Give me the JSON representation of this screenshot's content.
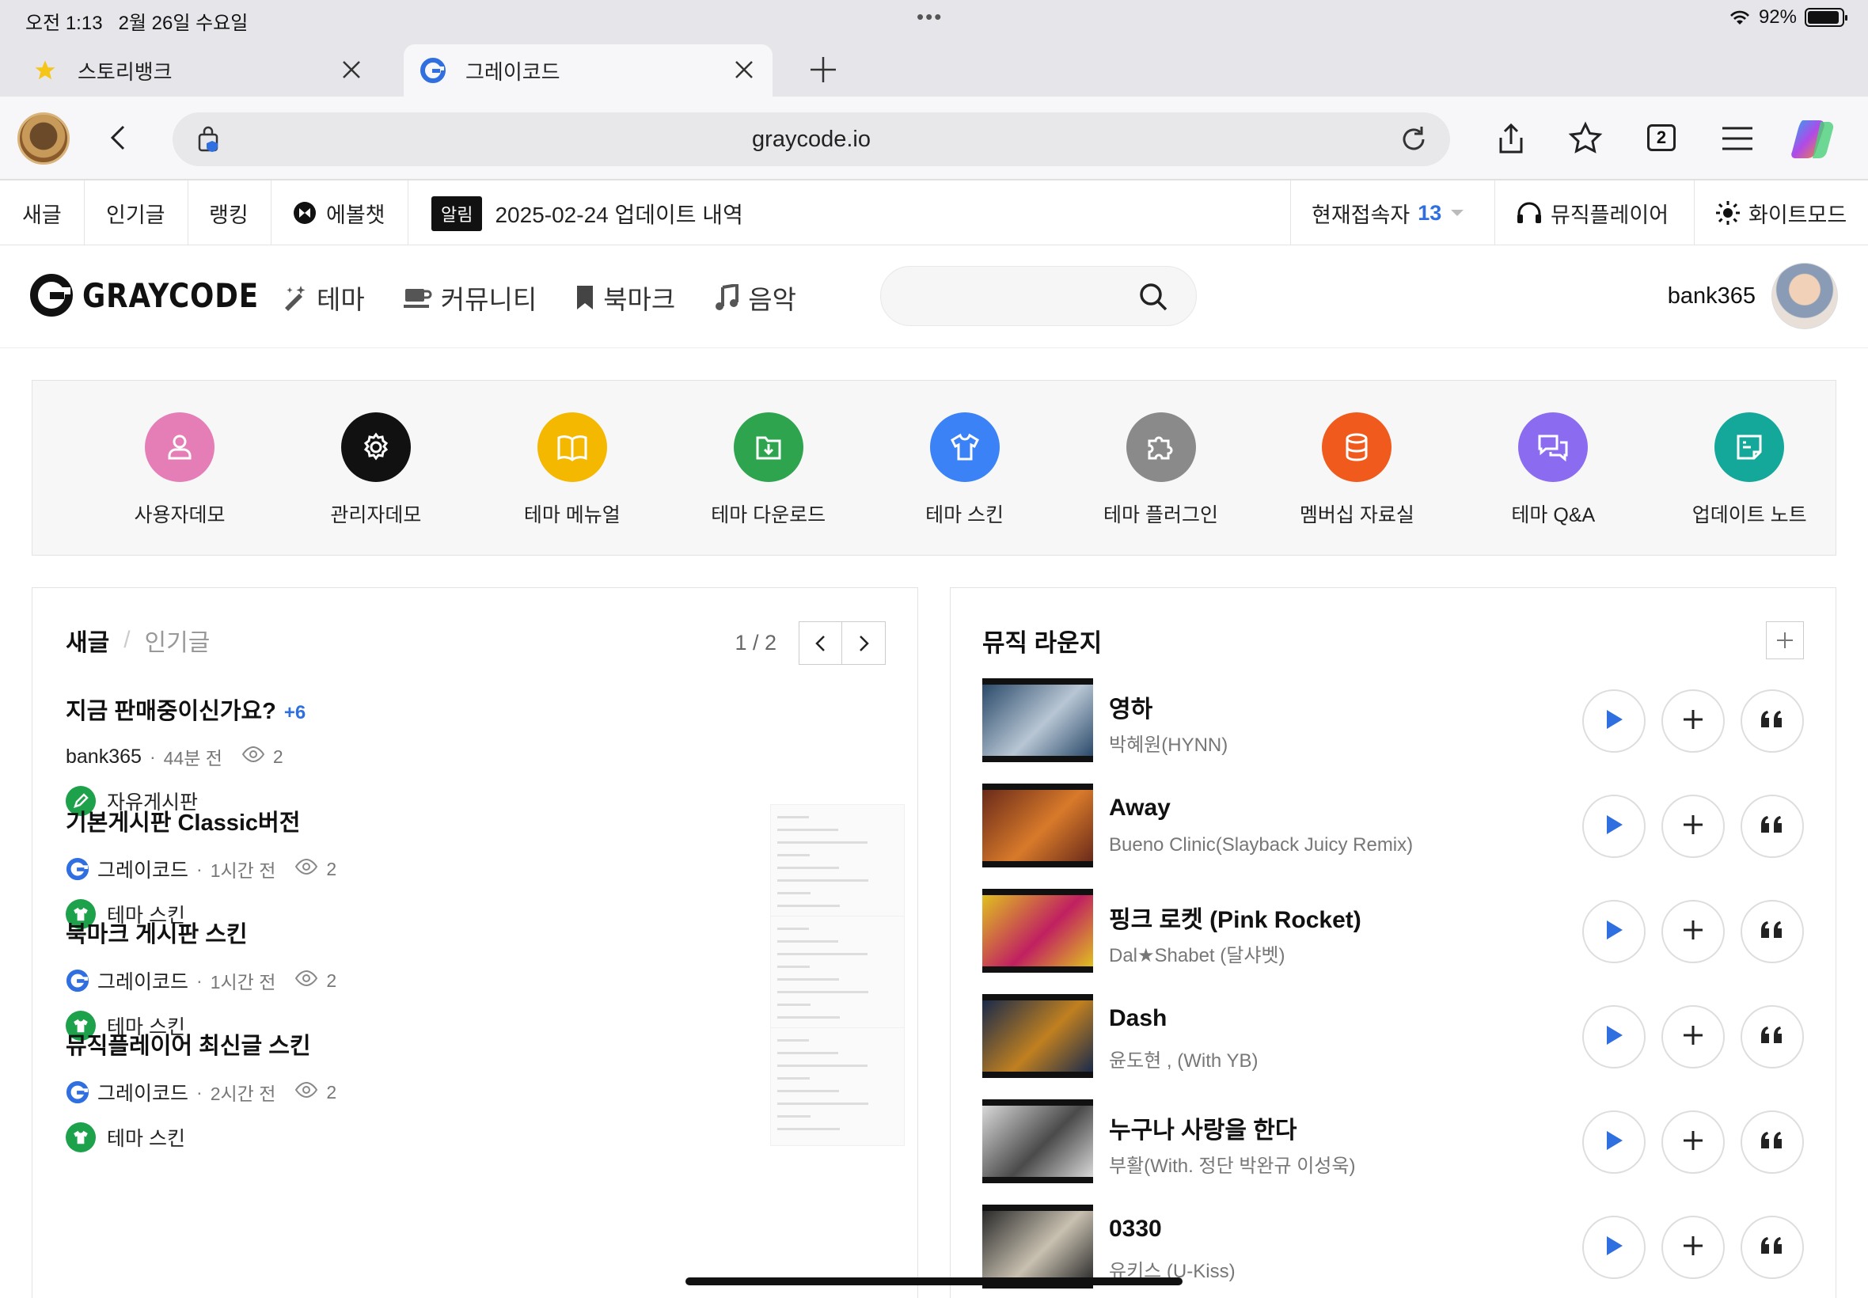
{
  "status": {
    "time": "오전 1:13",
    "date": "2월 26일 수요일",
    "battery": "92%",
    "battery_level": 0.92
  },
  "browser_tabs": [
    {
      "label": "스토리뱅크",
      "icon": "star-icon"
    },
    {
      "label": "그레이코드",
      "icon": "graycode-logo-icon"
    }
  ],
  "address": {
    "url": "graycode.io",
    "tab_count": "2"
  },
  "sitebar": {
    "new": "새글",
    "popular": "인기글",
    "ranking": "랭킹",
    "chat": "에볼챗",
    "alert_badge": "알림",
    "alert_text": "2025-02-24 업데이트 내역",
    "online_label": "현재접속자",
    "online_count": "13",
    "music_player": "뮤직플레이어",
    "white_mode": "화이트모드"
  },
  "header": {
    "logo": "GRAYCODE",
    "nav": [
      "테마",
      "커뮤니티",
      "북마크",
      "음악"
    ],
    "username": "bank365"
  },
  "quick_menu": [
    {
      "label": "사용자데모",
      "color": "#e57eb6",
      "icon": "user-icon"
    },
    {
      "label": "관리자데모",
      "color": "#111111",
      "icon": "gear-icon"
    },
    {
      "label": "테마 메뉴얼",
      "color": "#f5b800",
      "icon": "book-icon"
    },
    {
      "label": "테마 다운로드",
      "color": "#2ea44f",
      "icon": "download-icon"
    },
    {
      "label": "테마 스킨",
      "color": "#3b82f6",
      "icon": "shirt-icon"
    },
    {
      "label": "테마 플러그인",
      "color": "#8a8a8a",
      "icon": "puzzle-icon"
    },
    {
      "label": "멤버십 자료실",
      "color": "#f05a1c",
      "icon": "database-icon"
    },
    {
      "label": "테마 Q&A",
      "color": "#8b6cf0",
      "icon": "chat-icon"
    },
    {
      "label": "업데이트 노트",
      "color": "#14a89a",
      "icon": "note-icon"
    }
  ],
  "posts_panel": {
    "tab_active": "새글",
    "tab_inactive": "인기글",
    "page": "1 / 2",
    "posts": [
      {
        "title": "지금 판매중이신가요?",
        "count": "+6",
        "author": "bank365",
        "time": "44분 전",
        "views": "2",
        "category": "자유게시판",
        "cat_icon": "pencil-icon",
        "has_logo": false,
        "thumb": false
      },
      {
        "title": "기본게시판 Classic버전",
        "count": "",
        "author": "그레이코드",
        "time": "1시간 전",
        "views": "2",
        "category": "테마 스킨",
        "cat_icon": "shirt-icon",
        "has_logo": true,
        "thumb": true
      },
      {
        "title": "북마크 게시판 스킨",
        "count": "",
        "author": "그레이코드",
        "time": "1시간 전",
        "views": "2",
        "category": "테마 스킨",
        "cat_icon": "shirt-icon",
        "has_logo": true,
        "thumb": true
      },
      {
        "title": "뮤직플레이어 최신글 스킨",
        "count": "",
        "author": "그레이코드",
        "time": "2시간 전",
        "views": "2",
        "category": "테마 스킨",
        "cat_icon": "shirt-icon",
        "has_logo": true,
        "thumb": true
      }
    ]
  },
  "music_panel": {
    "title": "뮤직 라운지",
    "songs": [
      {
        "title": "영하",
        "artist": "박혜원(HYNN)",
        "art_colors": [
          "#2a4a6a",
          "#b8c6d4"
        ]
      },
      {
        "title": "Away",
        "artist": "Bueno Clinic(Slayback Juicy Remix)",
        "art_colors": [
          "#6a2a1a",
          "#d87a2a"
        ]
      },
      {
        "title": "핑크 로켓 (Pink Rocket)",
        "artist": "Dal★Shabet (달샤벳)",
        "art_colors": [
          "#e0c020",
          "#c02060"
        ]
      },
      {
        "title": "Dash",
        "artist": "윤도현 , (With YB)",
        "art_colors": [
          "#1a2a4a",
          "#c08020"
        ]
      },
      {
        "title": "누구나 사랑을 한다",
        "artist": "부활(With. 정단 박완규 이성욱)",
        "art_colors": [
          "#d8d8d8",
          "#4a4a4a"
        ]
      },
      {
        "title": "0330",
        "artist": "유키스 (U-Kiss)",
        "art_colors": [
          "#2a2a2a",
          "#c8c0b0"
        ]
      }
    ]
  }
}
